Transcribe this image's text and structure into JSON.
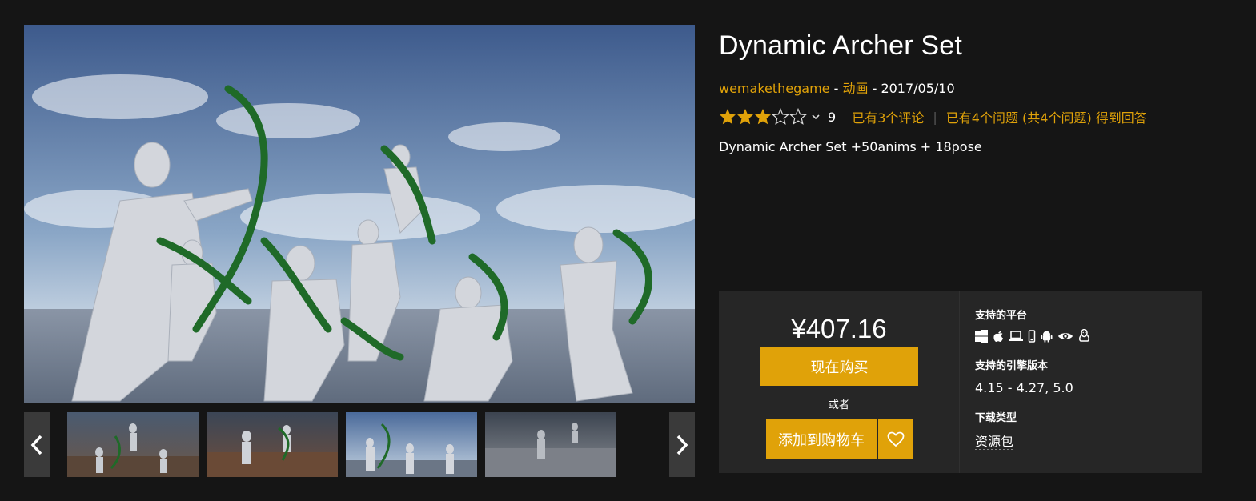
{
  "product": {
    "title": "Dynamic Archer Set",
    "seller": "wemakethegame",
    "separator": " - ",
    "category": "动画",
    "date": "2017/05/10",
    "rating": {
      "stars_filled": 3,
      "stars_total": 5,
      "count": "9",
      "reviews_link": "已有3个评论",
      "questions_link": "已有4个问题 (共4个问题) 得到回答"
    },
    "short_description": "Dynamic Archer Set +50anims + 18pose"
  },
  "purchase": {
    "price": "¥407.16",
    "buy_now": "现在购买",
    "or": "或者",
    "add_to_cart": "添加到购物车"
  },
  "info": {
    "platforms_label": "支持的平台",
    "platform_icons": [
      "windows-icon",
      "apple-icon",
      "laptop-icon",
      "mobile-icon",
      "android-icon",
      "eye-icon",
      "linux-icon"
    ],
    "engine_label": "支持的引擎版本",
    "engine_versions": "4.15 - 4.27, 5.0",
    "download_label": "下载类型",
    "download_type": "资源包"
  },
  "gallery": {
    "thumbnails": [
      "thumbnail-1",
      "thumbnail-2",
      "thumbnail-3",
      "thumbnail-4"
    ],
    "active_index": 2
  },
  "colors": {
    "accent": "#e0a209",
    "background": "#151515",
    "panel": "#262626"
  }
}
